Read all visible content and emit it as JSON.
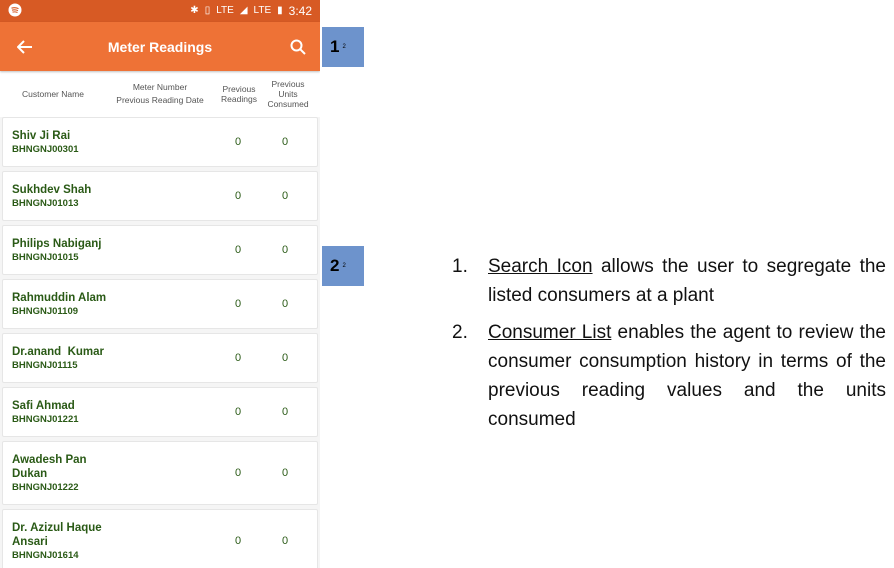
{
  "status_bar": {
    "time": "3:42",
    "network1": "LTE",
    "network2": "LTE"
  },
  "appbar": {
    "title": "Meter Readings"
  },
  "columns": {
    "customer": "Customer Name",
    "meter_line1": "Meter Number",
    "meter_line2": "Previous Reading Date",
    "prev_readings_l1": "Previous",
    "prev_readings_l2": "Readings",
    "prev_units_l1": "Previous",
    "prev_units_l2": "Units",
    "prev_units_l3": "Consumed"
  },
  "customers": [
    {
      "name": "Shiv Ji Rai",
      "id": "BHNGNJ00301",
      "prev_reading": "0",
      "units": "0"
    },
    {
      "name": "Sukhdev Shah",
      "id": "BHNGNJ01013",
      "prev_reading": "0",
      "units": "0"
    },
    {
      "name": "Philips Nabiganj",
      "id": "BHNGNJ01015",
      "prev_reading": "0",
      "units": "0"
    },
    {
      "name": "Rahmuddin Alam",
      "id": "BHNGNJ01109",
      "prev_reading": "0",
      "units": "0"
    },
    {
      "name": "Dr.anand  Kumar",
      "id": "BHNGNJ01115",
      "prev_reading": "0",
      "units": "0"
    },
    {
      "name": "Safi Ahmad",
      "id": "BHNGNJ01221",
      "prev_reading": "0",
      "units": "0"
    },
    {
      "name": "Awadesh Pan Dukan",
      "id": "BHNGNJ01222",
      "prev_reading": "0",
      "units": "0"
    },
    {
      "name": "Dr. Azizul Haque Ansari",
      "id": "BHNGNJ01614",
      "prev_reading": "0",
      "units": "0"
    }
  ],
  "badges": [
    {
      "number": "1",
      "sub": "2"
    },
    {
      "number": "2",
      "sub": "2"
    }
  ],
  "notes": [
    {
      "num": "1.",
      "highlight": "Search Icon",
      "text": " allows the user to segregate the listed consumers at a plant"
    },
    {
      "num": "2.",
      "highlight": "Consumer List",
      "text": " enables the agent to review the consumer consumption history in terms of the previous reading values and the units consumed"
    }
  ],
  "colors": {
    "appbar": "#ee7236",
    "statusbar": "#d75a24",
    "badge": "#6d93cc",
    "text_green": "#2a5a16"
  }
}
